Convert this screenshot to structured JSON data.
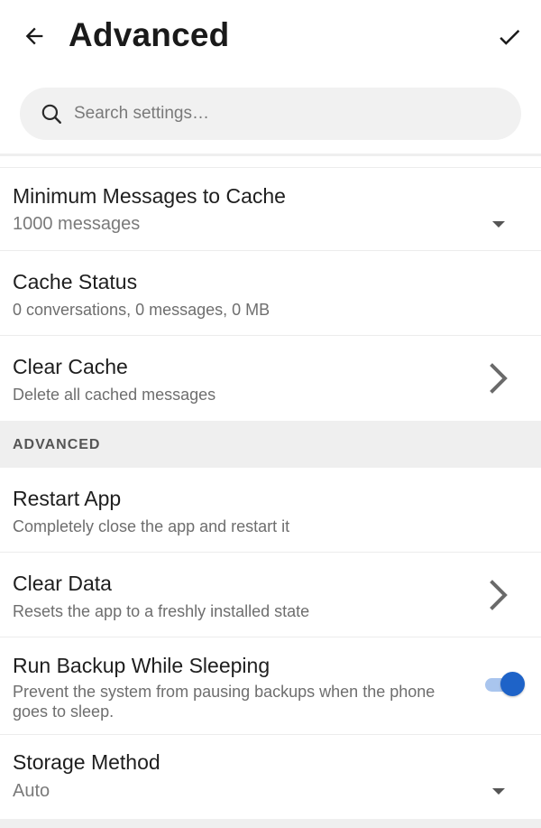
{
  "header": {
    "title": "Advanced",
    "back_icon": "arrow-left-icon",
    "confirm_icon": "check-icon"
  },
  "search": {
    "placeholder": "Search settings…",
    "icon": "search-icon"
  },
  "items": [
    {
      "title": "Minimum Messages to Cache",
      "subtitle": "1000 messages",
      "control": "dropdown"
    },
    {
      "title": "Cache Status",
      "subtitle": "0 conversations, 0 messages, 0 MB",
      "control": "none"
    },
    {
      "title": "Clear Cache",
      "subtitle": "Delete all cached messages",
      "control": "chevron"
    }
  ],
  "section": {
    "label": "ADVANCED"
  },
  "advanced_items": [
    {
      "title": "Restart App",
      "subtitle": "Completely close the app and restart it",
      "control": "none"
    },
    {
      "title": "Clear Data",
      "subtitle": "Resets the app to a freshly installed state",
      "control": "chevron"
    },
    {
      "title": "Run Backup While Sleeping",
      "subtitle": "Prevent the system from pausing backups when the phone goes to sleep.",
      "control": "toggle",
      "enabled": true
    },
    {
      "title": "Storage Method",
      "subtitle": "Auto",
      "control": "dropdown"
    }
  ],
  "colors": {
    "accent": "#1e63c8",
    "accent_track": "#a9c5ee",
    "section_bg": "#efefef",
    "secondary_text": "#6e6e6e"
  }
}
